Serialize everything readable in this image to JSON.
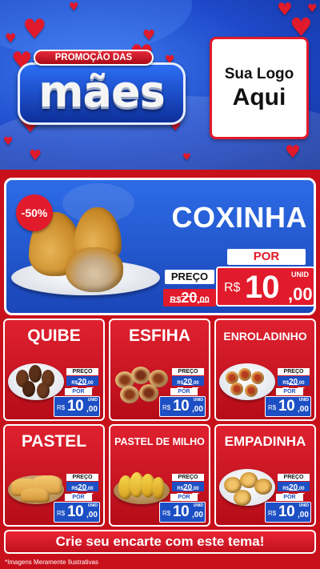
{
  "header": {
    "promo_badge": "PROMOÇÃO DAS",
    "headline": "mães",
    "logo_line1": "Sua Logo",
    "logo_line2": "Aqui"
  },
  "featured": {
    "discount": "-50%",
    "name": "COXINHA",
    "old_price_label": "PREÇO",
    "old_price": {
      "currency": "R$",
      "int": "20",
      "dec": ",00"
    },
    "new_price_label": "POR",
    "new_price": {
      "currency": "R$",
      "int": "10",
      "dec": ",00",
      "unit": "UNID"
    }
  },
  "products": [
    {
      "name": "QUIBE",
      "preco_label": "PREÇO",
      "old": {
        "currency": "R$",
        "int": "20",
        "dec": ",00"
      },
      "por_label": "POR",
      "new": {
        "currency": "R$",
        "int": "10",
        "dec": ",00",
        "unit": "UNID"
      }
    },
    {
      "name": "ESFIHA",
      "preco_label": "PREÇO",
      "old": {
        "currency": "R$",
        "int": "20",
        "dec": ",00"
      },
      "por_label": "POR",
      "new": {
        "currency": "R$",
        "int": "10",
        "dec": ",00",
        "unit": "UNID"
      }
    },
    {
      "name": "ENROLADINHO",
      "preco_label": "PREÇO",
      "old": {
        "currency": "R$",
        "int": "20",
        "dec": ",00"
      },
      "por_label": "POR",
      "new": {
        "currency": "R$",
        "int": "10",
        "dec": ",00",
        "unit": "UNID"
      }
    },
    {
      "name": "PASTEL",
      "preco_label": "PREÇO",
      "old": {
        "currency": "R$",
        "int": "20",
        "dec": ",00"
      },
      "por_label": "POR",
      "new": {
        "currency": "R$",
        "int": "10",
        "dec": ",00",
        "unit": "UNID"
      }
    },
    {
      "name": "PASTEL DE MILHO",
      "preco_label": "PREÇO",
      "old": {
        "currency": "R$",
        "int": "20",
        "dec": ",00"
      },
      "por_label": "POR",
      "new": {
        "currency": "R$",
        "int": "10",
        "dec": ",00",
        "unit": "UNID"
      }
    },
    {
      "name": "EMPADINHA",
      "preco_label": "PREÇO",
      "old": {
        "currency": "R$",
        "int": "20",
        "dec": ",00"
      },
      "por_label": "POR",
      "new": {
        "currency": "R$",
        "int": "10",
        "dec": ",00",
        "unit": "UNID"
      }
    }
  ],
  "footer": {
    "cta": "Crie seu encarte com este tema!",
    "disclaimer": "*Imagens Meramente Ilustrativas"
  },
  "colors": {
    "brand_red": "#e11b2b",
    "brand_blue": "#1d4fc4",
    "background_red": "#c8101a"
  }
}
